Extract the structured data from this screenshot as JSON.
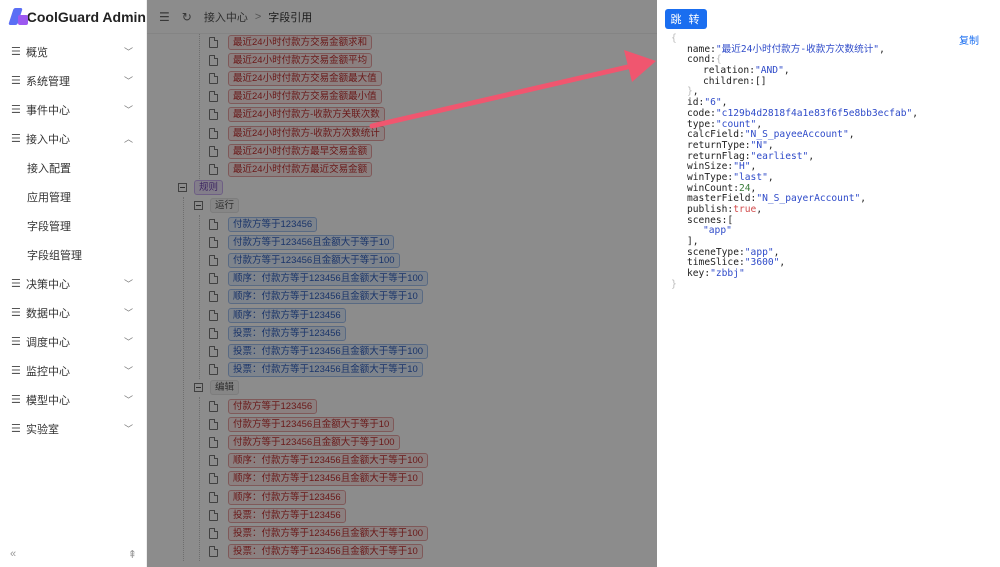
{
  "app": {
    "title": "CoolGuard Admin"
  },
  "sidebar": {
    "items": [
      {
        "label": "概览",
        "expanded": false
      },
      {
        "label": "系统管理",
        "expanded": false
      },
      {
        "label": "事件中心",
        "expanded": false
      },
      {
        "label": "接入中心",
        "expanded": true
      },
      {
        "label": "决策中心",
        "expanded": false
      },
      {
        "label": "数据中心",
        "expanded": false
      },
      {
        "label": "调度中心",
        "expanded": false
      },
      {
        "label": "监控中心",
        "expanded": false
      },
      {
        "label": "模型中心",
        "expanded": false
      },
      {
        "label": "实验室",
        "expanded": false
      }
    ],
    "subitems": [
      "接入配置",
      "应用管理",
      "字段管理",
      "字段组管理"
    ],
    "collapse_icon": "«",
    "pin_icon": "⇞"
  },
  "header": {
    "breadcrumb": [
      "接入中心",
      "字段引用"
    ],
    "separator": ">"
  },
  "tree": {
    "top_tags": [
      "最近24小时付款方交易金额求和",
      "最近24小时付款方交易金额平均",
      "最近24小时付款方交易金额最大值",
      "最近24小时付款方交易金额最小值",
      "最近24小时付款方-收款方关联次数",
      "最近24小时付款方-收款方次数统计",
      "最近24小时付款方最早交易金额",
      "最近24小时付款方最近交易金额"
    ],
    "rule_label": "规则",
    "run_label": "运行",
    "run_tags": [
      "付款方等于123456",
      "付款方等于123456且金额大于等于10",
      "付款方等于123456且金额大于等于100",
      "顺序：付款方等于123456且金额大于等于100",
      "顺序：付款方等于123456且金额大于等于10",
      "顺序：付款方等于123456",
      "投票：付款方等于123456",
      "投票：付款方等于123456且金额大于等于100",
      "投票：付款方等于123456且金额大于等于10"
    ],
    "edit_label": "编辑",
    "edit_tags": [
      "付款方等于123456",
      "付款方等于123456且金额大于等于10",
      "付款方等于123456且金额大于等于100",
      "顺序：付款方等于123456且金额大于等于100",
      "顺序：付款方等于123456且金额大于等于10",
      "顺序：付款方等于123456",
      "投票：付款方等于123456",
      "投票：付款方等于123456且金额大于等于100",
      "投票：付款方等于123456且金额大于等于10"
    ]
  },
  "drawer": {
    "jump_label": "跳 转",
    "copy_label": "复制",
    "json_lines": [
      {
        "indent": 0,
        "parts": [
          {
            "t": "brace",
            "v": "{"
          }
        ]
      },
      {
        "indent": 1,
        "parts": [
          {
            "t": "key",
            "v": "name:"
          },
          {
            "t": "str",
            "v": "\"最近24小时付款方-收款方次数统计\""
          },
          {
            "t": "key",
            "v": ","
          }
        ]
      },
      {
        "indent": 1,
        "parts": [
          {
            "t": "key",
            "v": "cond:"
          },
          {
            "t": "brace",
            "v": "{"
          }
        ]
      },
      {
        "indent": 2,
        "parts": [
          {
            "t": "key",
            "v": "relation:"
          },
          {
            "t": "str",
            "v": "\"AND\""
          },
          {
            "t": "key",
            "v": ","
          }
        ]
      },
      {
        "indent": 2,
        "parts": [
          {
            "t": "key",
            "v": "children:[]"
          }
        ]
      },
      {
        "indent": 1,
        "parts": [
          {
            "t": "brace",
            "v": "}"
          },
          {
            "t": "key",
            "v": ","
          }
        ]
      },
      {
        "indent": 1,
        "parts": [
          {
            "t": "key",
            "v": "id:"
          },
          {
            "t": "str",
            "v": "\"6\""
          },
          {
            "t": "key",
            "v": ","
          }
        ]
      },
      {
        "indent": 1,
        "parts": [
          {
            "t": "key",
            "v": "code:"
          },
          {
            "t": "str",
            "v": "\"c129b4d2818f4a1e83f6f5e8bb3ecfab\""
          },
          {
            "t": "key",
            "v": ","
          }
        ]
      },
      {
        "indent": 1,
        "parts": [
          {
            "t": "key",
            "v": "type:"
          },
          {
            "t": "str",
            "v": "\"count\""
          },
          {
            "t": "key",
            "v": ","
          }
        ]
      },
      {
        "indent": 1,
        "parts": [
          {
            "t": "key",
            "v": "calcField:"
          },
          {
            "t": "str",
            "v": "\"N_S_payeeAccount\""
          },
          {
            "t": "key",
            "v": ","
          }
        ]
      },
      {
        "indent": 1,
        "parts": [
          {
            "t": "key",
            "v": "returnType:"
          },
          {
            "t": "str",
            "v": "\"N\""
          },
          {
            "t": "key",
            "v": ","
          }
        ]
      },
      {
        "indent": 1,
        "parts": [
          {
            "t": "key",
            "v": "returnFlag:"
          },
          {
            "t": "str",
            "v": "\"earliest\""
          },
          {
            "t": "key",
            "v": ","
          }
        ]
      },
      {
        "indent": 1,
        "parts": [
          {
            "t": "key",
            "v": "winSize:"
          },
          {
            "t": "str",
            "v": "\"H\""
          },
          {
            "t": "key",
            "v": ","
          }
        ]
      },
      {
        "indent": 1,
        "parts": [
          {
            "t": "key",
            "v": "winType:"
          },
          {
            "t": "str",
            "v": "\"last\""
          },
          {
            "t": "key",
            "v": ","
          }
        ]
      },
      {
        "indent": 1,
        "parts": [
          {
            "t": "key",
            "v": "winCount:"
          },
          {
            "t": "num",
            "v": "24"
          },
          {
            "t": "key",
            "v": ","
          }
        ]
      },
      {
        "indent": 1,
        "parts": [
          {
            "t": "key",
            "v": "masterField:"
          },
          {
            "t": "str",
            "v": "\"N_S_payerAccount\""
          },
          {
            "t": "key",
            "v": ","
          }
        ]
      },
      {
        "indent": 1,
        "parts": [
          {
            "t": "key",
            "v": "publish:"
          },
          {
            "t": "bool",
            "v": "true"
          },
          {
            "t": "key",
            "v": ","
          }
        ]
      },
      {
        "indent": 1,
        "parts": [
          {
            "t": "key",
            "v": "scenes:["
          }
        ]
      },
      {
        "indent": 2,
        "parts": [
          {
            "t": "str",
            "v": "\"app\""
          }
        ]
      },
      {
        "indent": 1,
        "parts": [
          {
            "t": "key",
            "v": "],"
          }
        ]
      },
      {
        "indent": 1,
        "parts": [
          {
            "t": "key",
            "v": "sceneType:"
          },
          {
            "t": "str",
            "v": "\"app\""
          },
          {
            "t": "key",
            "v": ","
          }
        ]
      },
      {
        "indent": 1,
        "parts": [
          {
            "t": "key",
            "v": "timeSlice:"
          },
          {
            "t": "str",
            "v": "\"3600\""
          },
          {
            "t": "key",
            "v": ","
          }
        ]
      },
      {
        "indent": 1,
        "parts": [
          {
            "t": "key",
            "v": "key:"
          },
          {
            "t": "str",
            "v": "\"zbbj\""
          }
        ]
      },
      {
        "indent": 0,
        "parts": [
          {
            "t": "brace",
            "v": "}"
          }
        ]
      }
    ]
  },
  "colors": {
    "primary": "#1a6ef0",
    "arrow": "#f0566f",
    "overlay": "rgba(0,0,0,0.45)"
  }
}
